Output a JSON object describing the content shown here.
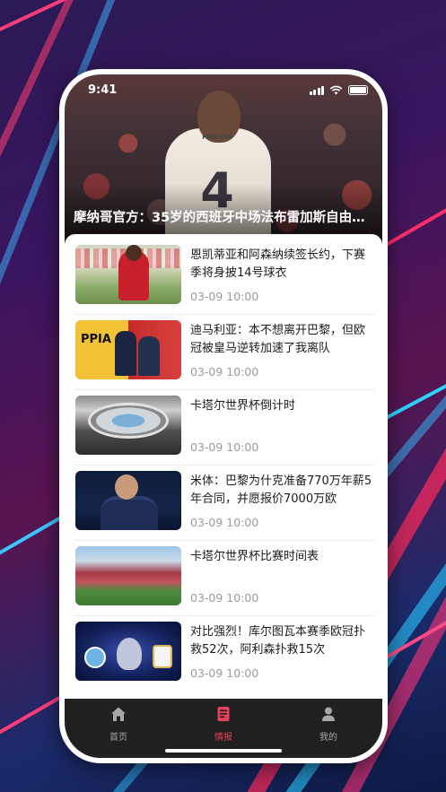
{
  "status_bar": {
    "time": "9:41"
  },
  "hero": {
    "title": "摩纳哥官方：35岁的西班牙中场法布雷加斯自由…",
    "jersey_number": "4",
    "jersey_sponsor": "FEDCOM"
  },
  "news": [
    {
      "title": "恩凯蒂亚和阿森纳续签长约，下赛季将身披14号球衣",
      "time": "03-09 10:00",
      "thumb": "arsenal-player-thumb"
    },
    {
      "title": "迪马利亚：本不想离开巴黎，但欧冠被皇马逆转加速了我离队",
      "time": "03-09 10:00",
      "thumb": "psg-newspaper-thumb",
      "thumb_text": "PPIA"
    },
    {
      "title": "卡塔尔世界杯倒计时",
      "time": "03-09 10:00",
      "thumb": "stadium-aerial-thumb"
    },
    {
      "title": "米体：巴黎为什克准备770万年薪5年合同，并愿报价7000万欧",
      "time": "03-09 10:00",
      "thumb": "inter-player-thumb"
    },
    {
      "title": "卡塔尔世界杯比赛时间表",
      "time": "03-09 10:00",
      "thumb": "stadium-pitch-thumb"
    },
    {
      "title": "对比强烈！库尔图瓦本赛季欧冠扑救52次，阿利森扑救15次",
      "time": "03-09 10:00",
      "thumb": "champions-league-thumb"
    }
  ],
  "tabbar": {
    "items": [
      {
        "label": "首页",
        "icon": "home-icon",
        "active": false
      },
      {
        "label": "情报",
        "icon": "document-icon",
        "active": true
      },
      {
        "label": "我的",
        "icon": "user-icon",
        "active": false
      }
    ]
  },
  "colors": {
    "accent": "#e8405a",
    "tabbar_bg": "#202020",
    "time_text": "#9b9b9b"
  }
}
